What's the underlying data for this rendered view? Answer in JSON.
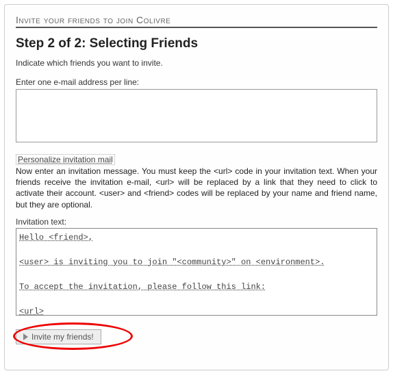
{
  "header": {
    "secondary_title": "Invite your friends to join Colivre",
    "main_title": "Step 2 of 2: Selecting Friends",
    "instruction": "Indicate which friends you want to invite."
  },
  "email_section": {
    "label": "Enter one e-mail address per line:",
    "value": ""
  },
  "personalize": {
    "link_text": "Personalize invitation mail",
    "help": "Now enter an invitation message. You must keep the <url> code in your invitation text. When your friends receive the invitation e-mail, <url> will be replaced by a link that they need to click to activate their account. <user> and <friend> codes will be replaced by your name and friend name, but they are optional."
  },
  "invitation": {
    "label": "Invitation text:",
    "value": "Hello <friend>,\n\n<user> is inviting you to join \"<community>\" on <environment>.\n\nTo accept the invitation, please follow this link:\n\n<url>\n\n--"
  },
  "submit": {
    "label": "Invite my friends!"
  }
}
